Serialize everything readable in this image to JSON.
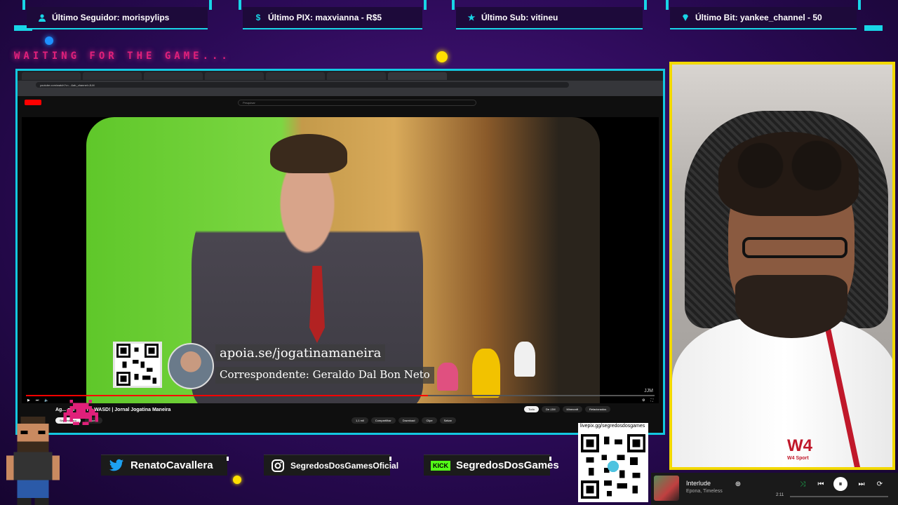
{
  "alerts": [
    {
      "label": "Último Seguidor: morispylips",
      "icon": "user-icon"
    },
    {
      "label": "Último PIX: maxvianna - R$5",
      "icon": "dollar-icon"
    },
    {
      "label": "Último Sub: vitineu",
      "icon": "star-icon"
    },
    {
      "label": "Último Bit: yankee_channel - 50",
      "icon": "diamond-icon"
    }
  ],
  "waiting_text": "WAITING FOR THE GAME...",
  "browser": {
    "address": "youtube.com/watch?v=...&ab_channel=JLM",
    "search_placeholder": "Pesquisar"
  },
  "video": {
    "overlay_url": "apoia.se/jogatinamaneira",
    "overlay_correspondent": "Correspondente: Geraldo Dal Bon Neto",
    "watermark": "JJM",
    "progress": 0.64,
    "title": "Ag... gar LoL no WASD! | Jornal Jogatina Maneira",
    "channel_pills": [
      "Seja membro",
      "Inscrito"
    ],
    "actions": [
      "1,1 mil",
      "Compartilhar",
      "Download",
      "Clipe",
      "Salvar"
    ],
    "chips": [
      "Tudo",
      "De JJM",
      "Minecraft",
      "Relacionados"
    ]
  },
  "socials": [
    {
      "icon": "twitter-icon",
      "label": "RenatoCavallera"
    },
    {
      "icon": "instagram-icon",
      "label": "SegredosDosGamesOficial"
    },
    {
      "icon": "kick-icon",
      "badge": "KICK",
      "label": "SegredosDosGames"
    }
  ],
  "qr_url": "livepix.gg/segredosdosgames",
  "webcam": {
    "brand": "W4",
    "brand_sub": "W4 Sport"
  },
  "music": {
    "song": "Interlude",
    "artist": "Epona, Timeless",
    "elapsed": "2:11",
    "progress": 0.0
  },
  "colors": {
    "accent_cyan": "#18d5e6",
    "webcam_border": "#f2d800",
    "waiting_pink": "#e0207a",
    "kick_green": "#53fc18"
  }
}
